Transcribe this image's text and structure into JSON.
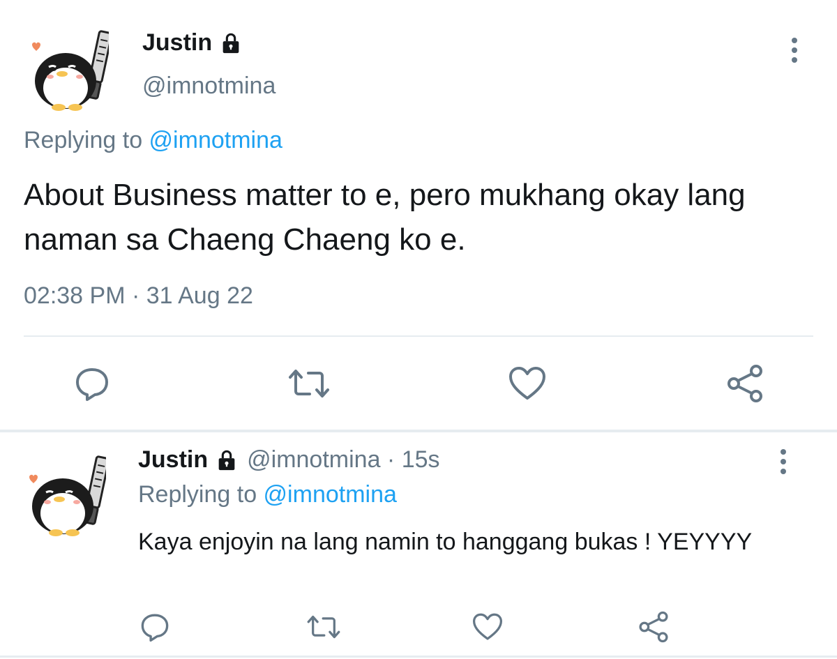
{
  "main_tweet": {
    "display_name": "Justin",
    "handle": "@imnotmina",
    "replying_prefix": "Replying to ",
    "replying_handle": "@imnotmina",
    "text": "About Business matter to e, pero mukhang okay lang naman sa Chaeng Chaeng ko e.",
    "timestamp": "02:38 PM · 31 Aug 22",
    "actions": [
      "reply-icon",
      "retweet-icon",
      "like-icon",
      "share-icon"
    ]
  },
  "reply_tweet": {
    "display_name": "Justin",
    "handle": "@imnotmina",
    "meta_separator": " · ",
    "age": "15s",
    "replying_prefix": "Replying to ",
    "replying_handle": "@imnotmina",
    "text": "Kaya enjoyin na lang namin to hanggang bukas ! YEYYYY",
    "actions": [
      "reply-icon",
      "retweet-icon",
      "like-icon",
      "share-icon"
    ]
  },
  "colors": {
    "text": "#14171a",
    "secondary": "#657786",
    "link": "#1da1f2",
    "icon": "#657786",
    "divider": "#e6ecf0"
  }
}
